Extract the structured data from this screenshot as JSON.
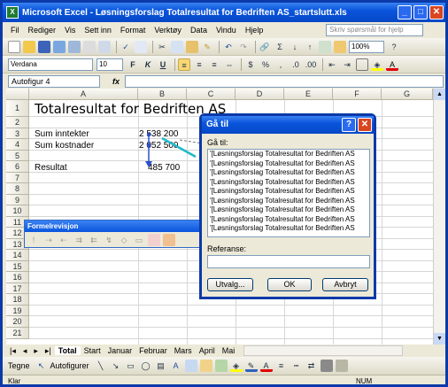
{
  "window": {
    "title": "Microsoft Excel - Løsningsforslag Totalresultat for Bedriften AS_startslutt.xls"
  },
  "menu": {
    "items": [
      "Fil",
      "Rediger",
      "Vis",
      "Sett inn",
      "Format",
      "Verktøy",
      "Data",
      "Vindu",
      "Hjelp"
    ],
    "help_placeholder": "Skriv spørsmål for hjelp"
  },
  "toolbar": {
    "zoom": "100%"
  },
  "format_toolbar": {
    "font": "Verdana",
    "size": "10",
    "bold": "F",
    "italic": "K",
    "underline": "U"
  },
  "formula": {
    "namebox": "Autofigur 4",
    "fx": "fx"
  },
  "grid": {
    "columns": [
      "A",
      "B",
      "C",
      "D",
      "E",
      "F",
      "G"
    ],
    "rows": [
      "1",
      "2",
      "3",
      "4",
      "5",
      "6",
      "7",
      "8",
      "9",
      "10",
      "11",
      "12",
      "13",
      "14",
      "15",
      "16",
      "17",
      "18",
      "19",
      "20",
      "21"
    ],
    "cells": {
      "a1": "Totalresultat for Bedriften AS",
      "a3": "Sum inntekter",
      "b3": "2 538 200",
      "a4": "Sum kostnader",
      "b4": "2 052 500",
      "a6": "Resultat",
      "b6": "485 700"
    }
  },
  "formelrevisjon": {
    "title": "Formelrevisjon"
  },
  "goto_dialog": {
    "title": "Gå til",
    "list_label": "Gå til:",
    "items": [
      "'[Løsningsforslag Totalresultat for Bedriften AS",
      "'[Løsningsforslag Totalresultat for Bedriften AS",
      "'[Løsningsforslag Totalresultat for Bedriften AS",
      "'[Løsningsforslag Totalresultat for Bedriften AS",
      "'[Løsningsforslag Totalresultat for Bedriften AS",
      "'[Løsningsforslag Totalresultat for Bedriften AS",
      "'[Løsningsforslag Totalresultat for Bedriften AS",
      "'[Løsningsforslag Totalresultat for Bedriften AS",
      "'[Løsningsforslag Totalresultat for Bedriften AS"
    ],
    "ref_label": "Referanse:",
    "ref_value": "",
    "btn_special": "Utvalg...",
    "btn_ok": "OK",
    "btn_cancel": "Avbryt"
  },
  "sheets": {
    "tabs": [
      "Total",
      "Start",
      "Januar",
      "Februar",
      "Mars",
      "April",
      "Mai"
    ],
    "active": "Total"
  },
  "drawing": {
    "draw": "Tegne",
    "autoshapes": "Autofigurer"
  },
  "status": {
    "left": "Klar",
    "right": "NUM"
  }
}
